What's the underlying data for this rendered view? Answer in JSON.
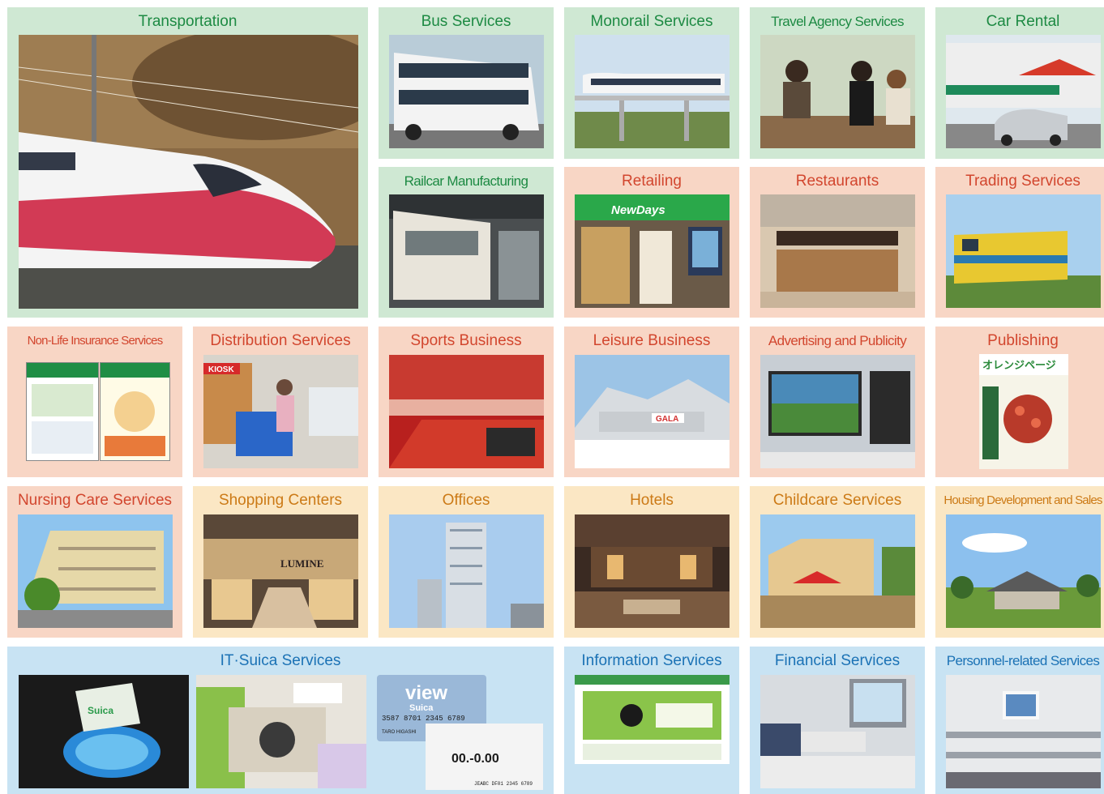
{
  "tiles": {
    "transportation": {
      "title": "Transportation"
    },
    "bus": {
      "title": "Bus Services"
    },
    "monorail": {
      "title": "Monorail Services"
    },
    "travel": {
      "title": "Travel Agency Services"
    },
    "car_rental": {
      "title": "Car Rental"
    },
    "railcar": {
      "title": "Railcar Manufacturing"
    },
    "retailing": {
      "title": "Retailing"
    },
    "restaurants": {
      "title": "Restaurants"
    },
    "trading": {
      "title": "Trading Services"
    },
    "insurance": {
      "title": "Non-Life Insurance Services"
    },
    "distribution": {
      "title": "Distribution Services"
    },
    "sports": {
      "title": "Sports Business"
    },
    "leisure": {
      "title": "Leisure Business"
    },
    "advertising": {
      "title": "Advertising and Publicity"
    },
    "publishing": {
      "title": "Publishing"
    },
    "nursing": {
      "title": "Nursing Care Services"
    },
    "shopping": {
      "title": "Shopping Centers"
    },
    "offices": {
      "title": "Offices"
    },
    "hotels": {
      "title": "Hotels"
    },
    "childcare": {
      "title": "Childcare Services"
    },
    "housing": {
      "title": "Housing Development and Sales"
    },
    "suica": {
      "title": "IT·Suica Services"
    },
    "information": {
      "title": "Information Services"
    },
    "financial": {
      "title": "Financial Services"
    },
    "personnel": {
      "title": "Personnel-related Services"
    }
  },
  "photo_text": {
    "newdays_sign": "NewDays",
    "kiosk_sign": "KIOSK",
    "lumine_sign": "LUMINE",
    "gala_sign": "GALA",
    "suica_card": "Suica",
    "view_card": "view",
    "view_suica": "Suica",
    "card_number": "3587 8701 2345 6789",
    "card_name": "TARO HIGASHI",
    "ticket_price": "00.-0.00",
    "ticket_code": "JEABC DF01 2345 6789",
    "magazine_title": "オレンジページ"
  },
  "colors": {
    "green_bg": "#cfe8d3",
    "green_text": "#1d8a43",
    "salmon_bg": "#f8d6c5",
    "salmon_text": "#d2462e",
    "cream_bg": "#fbe7c4",
    "cream_text": "#cc7a16",
    "blue_bg": "#c8e3f3",
    "blue_text": "#1b72b5"
  }
}
